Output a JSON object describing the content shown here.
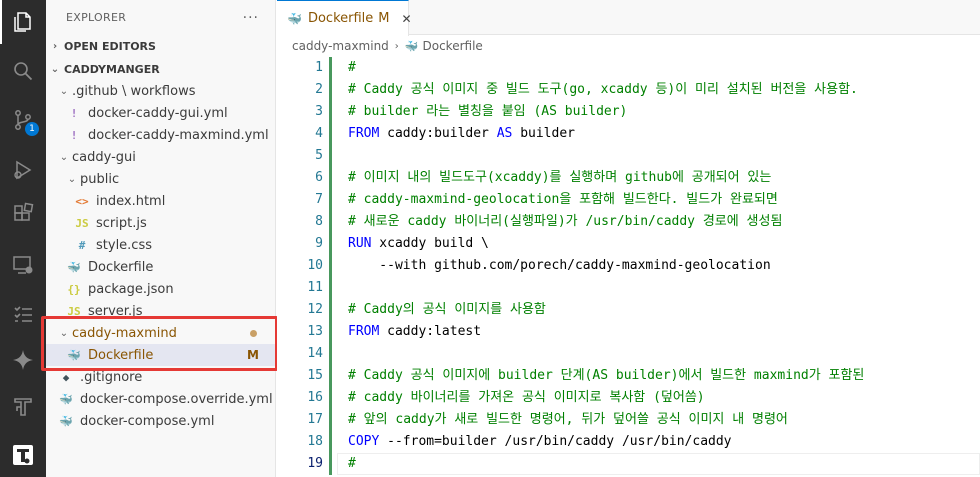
{
  "explorer": {
    "title": "EXPLORER",
    "more": "···",
    "open_editors": "OPEN EDITORS",
    "root": "CADDYMANGER",
    "items": [
      {
        "label": ".github \\ workflows"
      },
      {
        "label": "docker-caddy-gui.yml"
      },
      {
        "label": "docker-caddy-maxmind.yml"
      },
      {
        "label": "caddy-gui"
      },
      {
        "label": "public"
      },
      {
        "label": "index.html"
      },
      {
        "label": "script.js"
      },
      {
        "label": "style.css"
      },
      {
        "label": "Dockerfile"
      },
      {
        "label": "package.json"
      },
      {
        "label": "server.js"
      },
      {
        "label": "caddy-maxmind"
      },
      {
        "label": "Dockerfile",
        "status": "M"
      },
      {
        "label": ".gitignore"
      },
      {
        "label": "docker-compose.override.yml"
      },
      {
        "label": "docker-compose.yml"
      }
    ]
  },
  "activity": {
    "scm_badge": "1"
  },
  "tab": {
    "name": "Dockerfile",
    "status": "M",
    "close": "✕"
  },
  "breadcrumb": {
    "folder": "caddy-maxmind",
    "file": "Dockerfile"
  },
  "code": {
    "lines": [
      {
        "n": "1",
        "parts": [
          {
            "t": "#",
            "c": "com"
          }
        ]
      },
      {
        "n": "2",
        "parts": [
          {
            "t": "# Caddy 공식 이미지 중 빌드 도구(go, xcaddy 등)이 미리 설치된 버전을 사용함.",
            "c": "com"
          }
        ]
      },
      {
        "n": "3",
        "parts": [
          {
            "t": "# builder 라는 별칭을 붙임 (AS builder)",
            "c": "com"
          }
        ]
      },
      {
        "n": "4",
        "parts": [
          {
            "t": "FROM",
            "c": "kw"
          },
          {
            "t": " caddy:builder ",
            "c": "norm"
          },
          {
            "t": "AS",
            "c": "kw"
          },
          {
            "t": " builder",
            "c": "norm"
          }
        ]
      },
      {
        "n": "5",
        "parts": []
      },
      {
        "n": "6",
        "parts": [
          {
            "t": "# 이미지 내의 빌드도구(xcaddy)를 실행하며 github에 공개되어 있는",
            "c": "com"
          }
        ]
      },
      {
        "n": "7",
        "parts": [
          {
            "t": "# caddy-maxmind-geolocation을 포함해 빌드한다. 빌드가 완료되면",
            "c": "com"
          }
        ]
      },
      {
        "n": "8",
        "parts": [
          {
            "t": "# 새로운 caddy 바이너리(실행파일)가 /usr/bin/caddy 경로에 생성됨",
            "c": "com"
          }
        ]
      },
      {
        "n": "9",
        "parts": [
          {
            "t": "RUN",
            "c": "kw"
          },
          {
            "t": " xcaddy build \\",
            "c": "norm"
          }
        ]
      },
      {
        "n": "10",
        "parts": [
          {
            "t": "    --with github.com/porech/caddy-maxmind-geolocation",
            "c": "norm"
          }
        ]
      },
      {
        "n": "11",
        "parts": []
      },
      {
        "n": "12",
        "parts": [
          {
            "t": "# Caddy의 공식 이미지를 사용함",
            "c": "com"
          }
        ]
      },
      {
        "n": "13",
        "parts": [
          {
            "t": "FROM",
            "c": "kw"
          },
          {
            "t": " caddy:latest",
            "c": "norm"
          }
        ]
      },
      {
        "n": "14",
        "parts": []
      },
      {
        "n": "15",
        "parts": [
          {
            "t": "# Caddy 공식 이미지에 builder 단계(AS builder)에서 빌드한 maxmind가 포함된",
            "c": "com"
          }
        ]
      },
      {
        "n": "16",
        "parts": [
          {
            "t": "# caddy 바이너리를 가져온 공식 이미지로 복사함 (덮어씀)",
            "c": "com"
          }
        ]
      },
      {
        "n": "17",
        "parts": [
          {
            "t": "# 앞의 caddy가 새로 빌드한 명령어, 뒤가 덮어쓸 공식 이미지 내 명령어",
            "c": "com"
          }
        ]
      },
      {
        "n": "18",
        "parts": [
          {
            "t": "COPY",
            "c": "kw"
          },
          {
            "t": " --from=builder /usr/bin/caddy /usr/bin/caddy",
            "c": "norm"
          }
        ]
      },
      {
        "n": "19",
        "parts": [
          {
            "t": "#",
            "c": "com"
          }
        ]
      }
    ]
  }
}
